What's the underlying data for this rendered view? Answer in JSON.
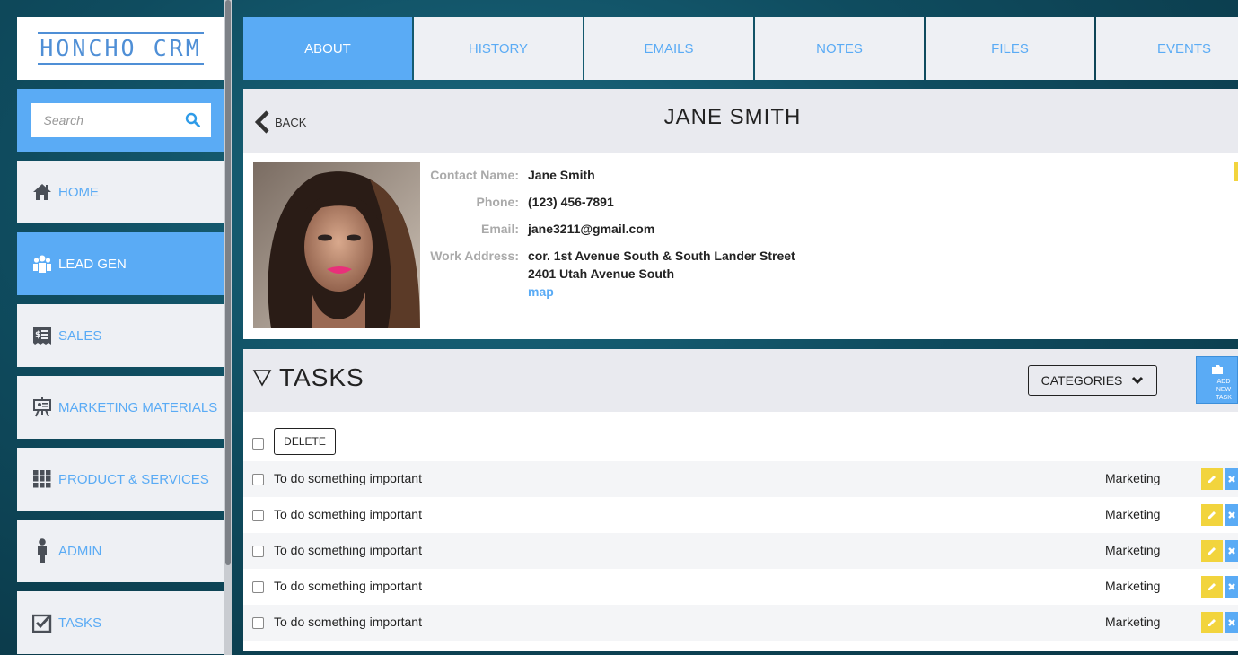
{
  "app": {
    "logo_text": "HONCHO CRM"
  },
  "search": {
    "placeholder": "Search"
  },
  "sidebar": {
    "items": [
      {
        "label": "HOME",
        "icon": "home-icon",
        "active": false
      },
      {
        "label": "LEAD GEN",
        "icon": "users-icon",
        "active": true
      },
      {
        "label": "SALES",
        "icon": "receipt-icon",
        "active": false
      },
      {
        "label": "MARKETING MATERIALS",
        "icon": "presentation-icon",
        "active": false
      },
      {
        "label": "PRODUCT & SERVICES",
        "icon": "grid-icon",
        "active": false
      },
      {
        "label": "ADMIN",
        "icon": "person-icon",
        "active": false
      },
      {
        "label": "TASKS",
        "icon": "checkbox-icon",
        "active": false
      }
    ]
  },
  "tabs": [
    {
      "label": "ABOUT",
      "active": true
    },
    {
      "label": "HISTORY",
      "active": false
    },
    {
      "label": "EMAILS",
      "active": false
    },
    {
      "label": "NOTES",
      "active": false
    },
    {
      "label": "FILES",
      "active": false
    },
    {
      "label": "EVENTS",
      "active": false
    }
  ],
  "header": {
    "back_label": "BACK",
    "title": "JANE SMITH"
  },
  "contact": {
    "name_label": "Contact Name:",
    "name": "Jane Smith",
    "phone_label": "Phone:",
    "phone": "(123) 456-7891",
    "email_label": "Email:",
    "email": "jane3211@gmail.com",
    "address_label": "Work Address:",
    "address_line1": "cor. 1st Avenue South & South Lander Street",
    "address_line2": "2401 Utah Avenue South",
    "map_link": "map"
  },
  "tasks": {
    "title": "TASKS",
    "categories_label": "CATEGORIES",
    "add_label": "ADD NEW TASK",
    "delete_label": "DELETE",
    "items": [
      {
        "text": "To do something important",
        "category": "Marketing"
      },
      {
        "text": "To do something important",
        "category": "Marketing"
      },
      {
        "text": "To do something important",
        "category": "Marketing"
      },
      {
        "text": "To do something important",
        "category": "Marketing"
      },
      {
        "text": "To do something important",
        "category": "Marketing"
      }
    ]
  },
  "colors": {
    "accent": "#5aabf5",
    "edit": "#f2d43d",
    "panel": "#eef0f4",
    "header": "#e9eaef"
  }
}
